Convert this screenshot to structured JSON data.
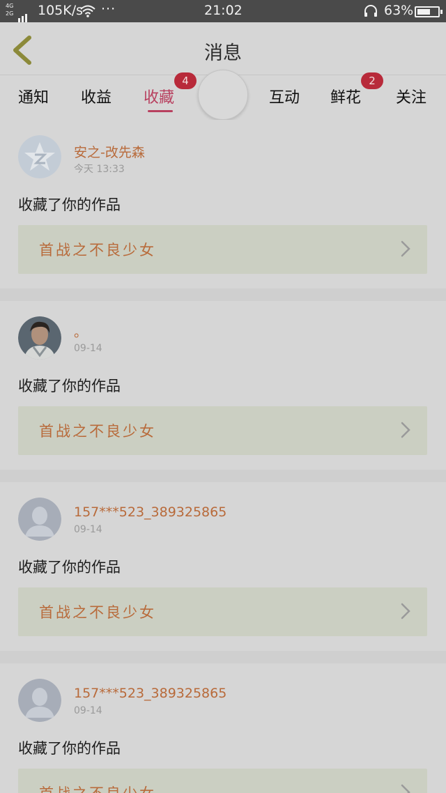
{
  "status_bar": {
    "net_top": "4G",
    "net_bottom": "2G",
    "speed": "105K/s",
    "more": "···",
    "time": "21:02",
    "battery_pct": "63%",
    "battery_level": 0.63,
    "icons": [
      "signal-icon",
      "wifi-icon",
      "headphones-icon",
      "battery-icon"
    ]
  },
  "header": {
    "title": "消息",
    "back_icon": "back-chevron-icon"
  },
  "tabs": [
    {
      "label": "通知"
    },
    {
      "label": "收益"
    },
    {
      "label": "收藏",
      "active": true,
      "badge": "4"
    },
    {
      "label": "互动"
    },
    {
      "label": "鲜花",
      "badge": "2"
    },
    {
      "label": "关注"
    }
  ],
  "colors": {
    "accent": "#b8405f",
    "badge": "#b82a3a",
    "name": "#b86a3a",
    "work_bg": "#cbcfc2"
  },
  "messages": [
    {
      "username": "安之-改先森",
      "time": "今天 13:33",
      "action": "收藏了你的作品",
      "work_title": "首战之不良少女",
      "avatar": "qq-star-avatar"
    },
    {
      "username": "。",
      "time": "09-14",
      "action": "收藏了你的作品",
      "work_title": "首战之不良少女",
      "avatar": "photo-avatar"
    },
    {
      "username": "157***523_389325865",
      "time": "09-14",
      "action": "收藏了你的作品",
      "work_title": "首战之不良少女",
      "avatar": "default-person-avatar"
    },
    {
      "username": "157***523_389325865",
      "time": "09-14",
      "action": "收藏了你的作品",
      "work_title": "首战之不良少女",
      "avatar": "default-person-avatar"
    }
  ]
}
